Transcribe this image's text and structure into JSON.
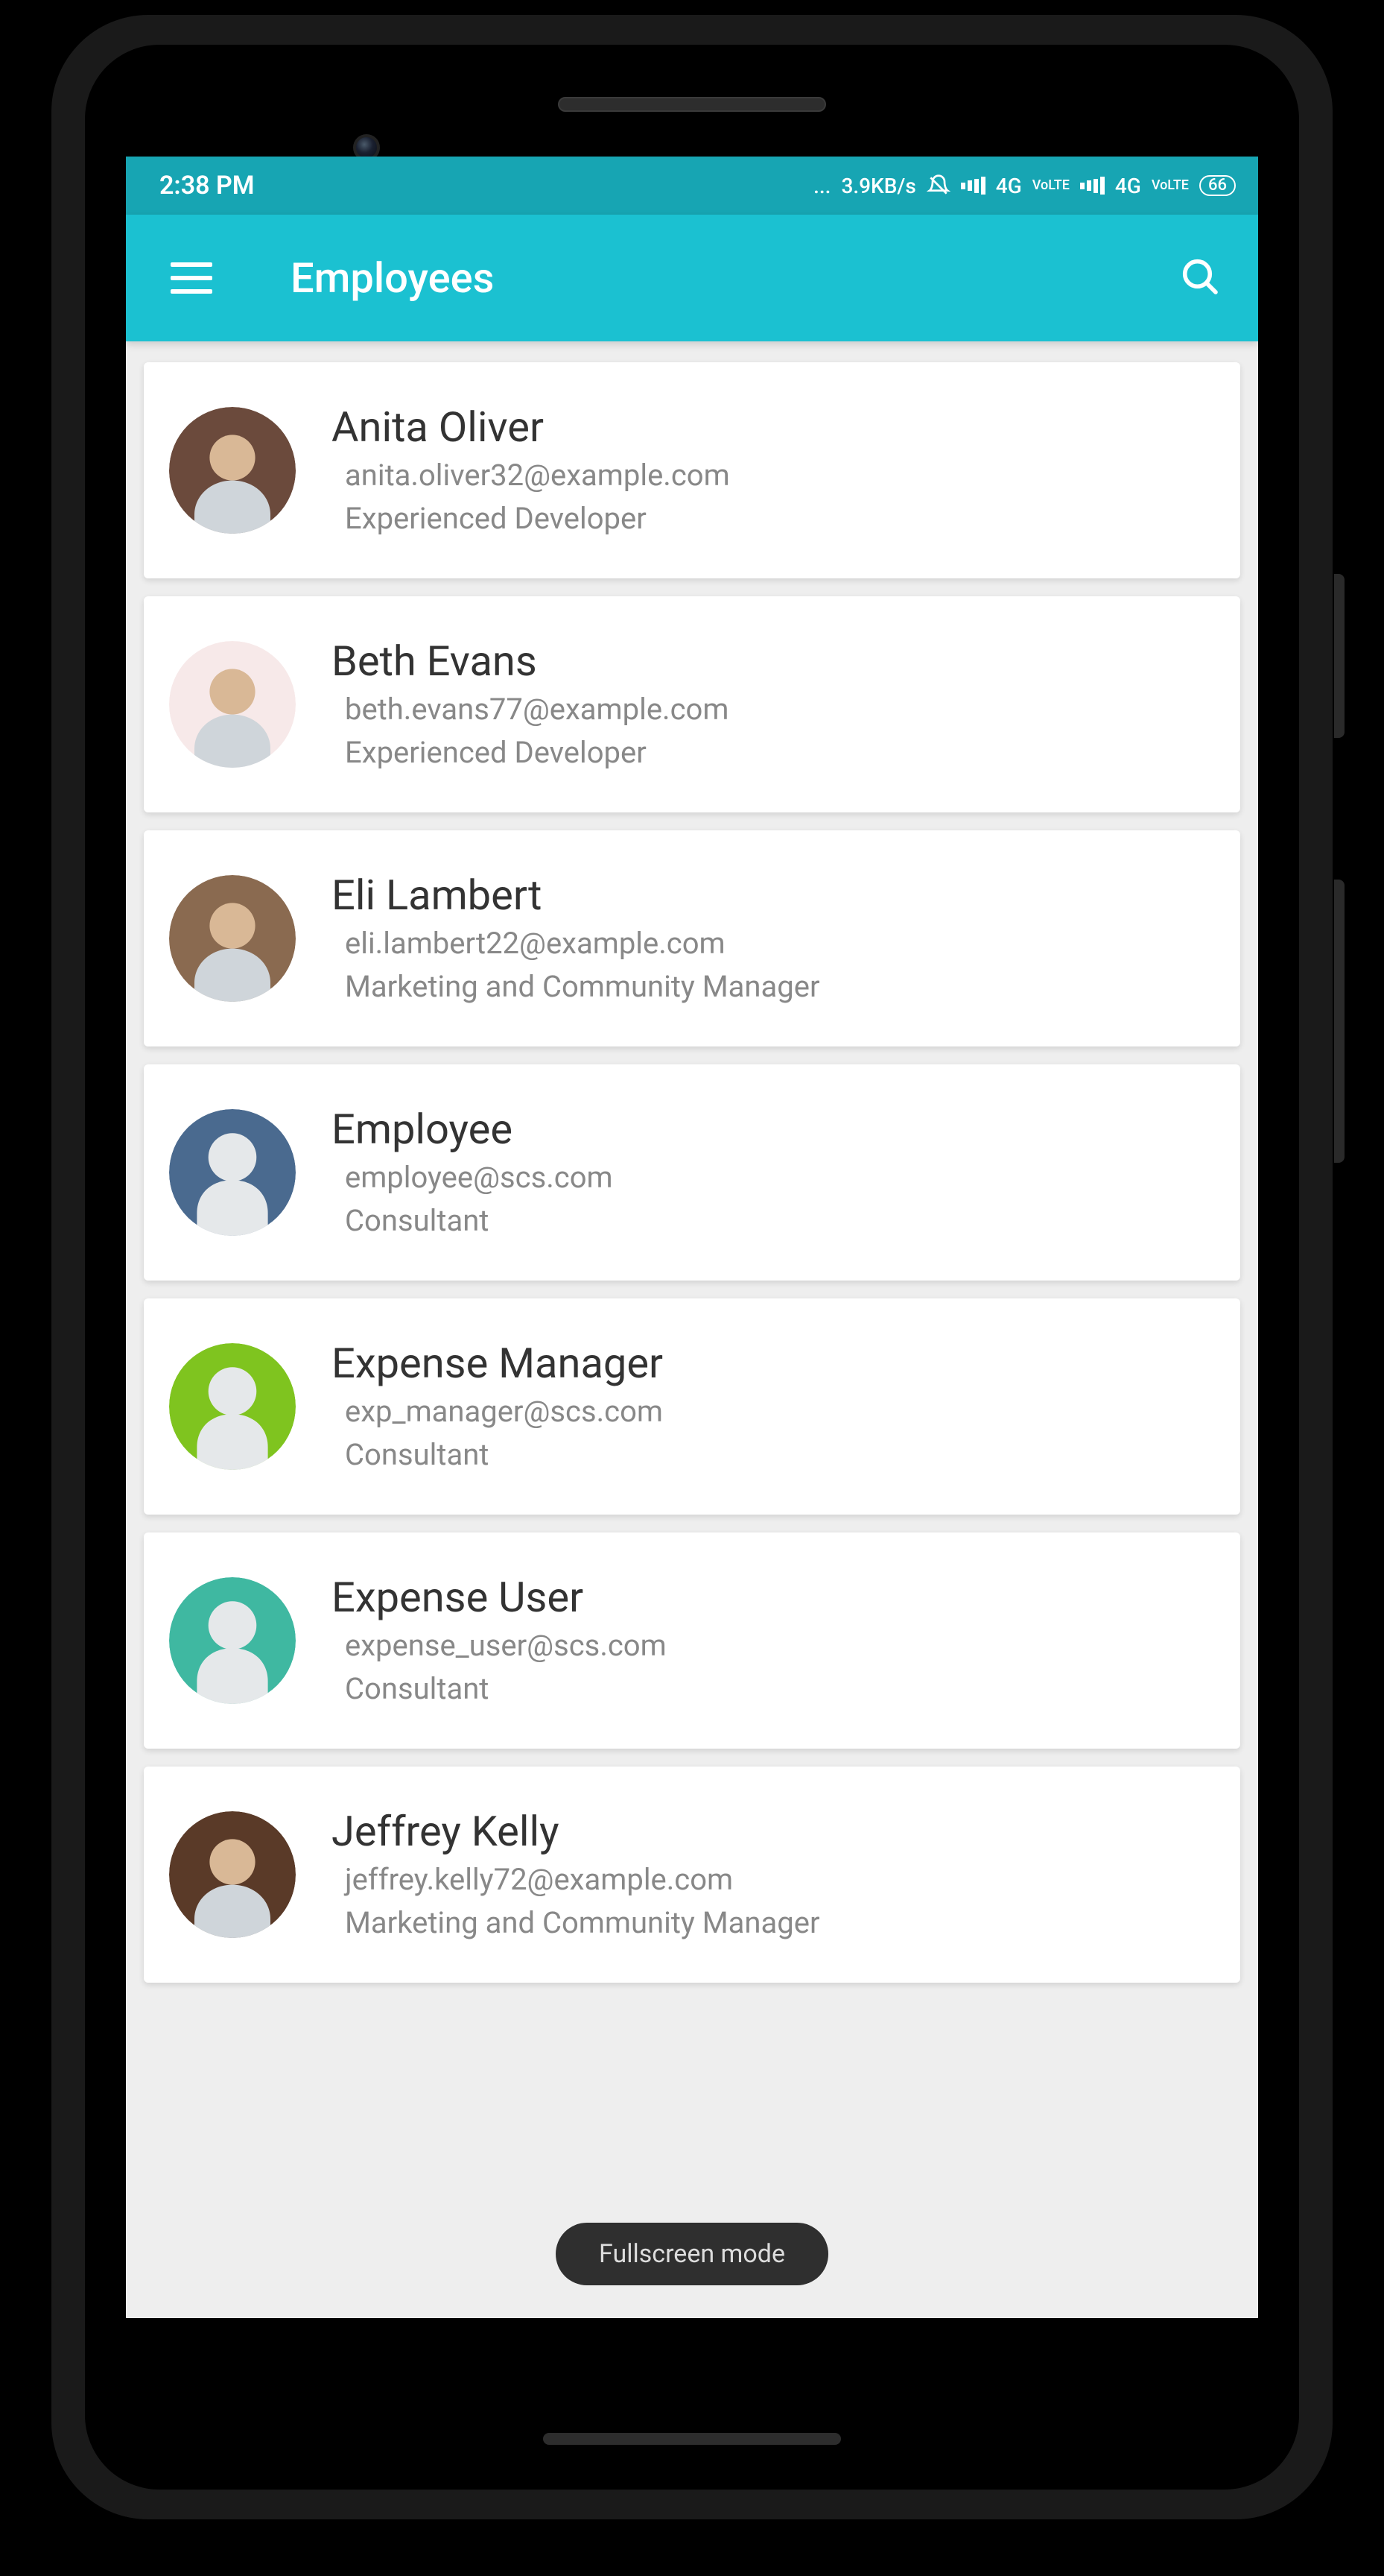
{
  "status": {
    "time": "2:38 PM",
    "net_speed": "3.9KB/s",
    "net_label_1": "4G",
    "volte_1": "VoLTE",
    "net_label_2": "4G",
    "volte_2": "VoLTE",
    "battery": "66"
  },
  "appbar": {
    "title": "Employees"
  },
  "employees": [
    {
      "name": "Anita Oliver",
      "email": "anita.oliver32@example.com",
      "role": "Experienced Developer",
      "avatar_type": "photo",
      "avatar_bg": "#6b4a3c"
    },
    {
      "name": "Beth Evans",
      "email": "beth.evans77@example.com",
      "role": "Experienced Developer",
      "avatar_type": "photo",
      "avatar_bg": "#f7e9e9"
    },
    {
      "name": "Eli Lambert",
      "email": "eli.lambert22@example.com",
      "role": "Marketing and Community Manager",
      "avatar_type": "photo",
      "avatar_bg": "#8a6a50"
    },
    {
      "name": "Employee",
      "email": "employee@scs.com",
      "role": "Consultant",
      "avatar_type": "placeholder",
      "avatar_bg": "#4a6a8f"
    },
    {
      "name": "Expense Manager",
      "email": "exp_manager@scs.com",
      "role": "Consultant",
      "avatar_type": "placeholder",
      "avatar_bg": "#7fc41f"
    },
    {
      "name": "Expense User",
      "email": "expense_user@scs.com",
      "role": "Consultant",
      "avatar_type": "placeholder",
      "avatar_bg": "#3fb8a1"
    },
    {
      "name": "Jeffrey Kelly",
      "email": "jeffrey.kelly72@example.com",
      "role": "Marketing and Community Manager",
      "avatar_type": "photo",
      "avatar_bg": "#5a3a28"
    }
  ],
  "toast": {
    "text": "Fullscreen mode"
  }
}
